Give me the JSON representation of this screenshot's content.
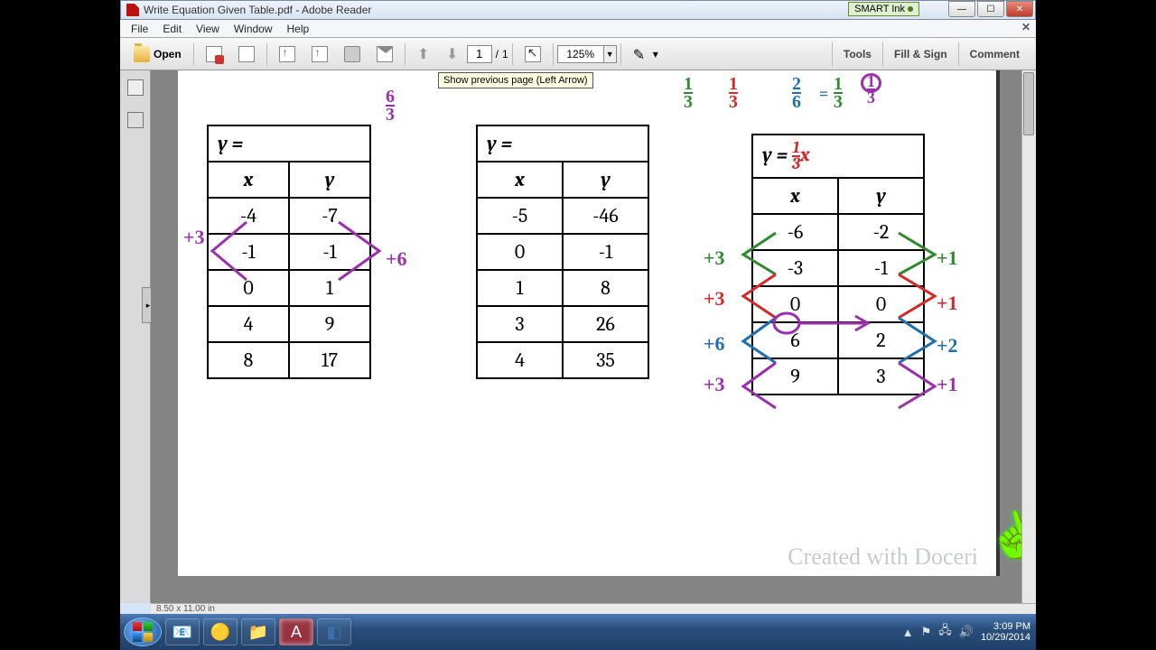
{
  "window": {
    "title": "Write Equation Given Table.pdf - Adobe Reader",
    "smart_ink": "SMART Ink"
  },
  "menu": {
    "file": "File",
    "edit": "Edit",
    "view": "View",
    "window": "Window",
    "help": "Help"
  },
  "toolbar": {
    "open": "Open",
    "page_current": "1",
    "page_total": "1",
    "page_sep": "/",
    "zoom": "125%",
    "tools": "Tools",
    "fill_sign": "Fill & Sign",
    "comment": "Comment"
  },
  "tooltip": "Show previous page (Left Arrow)",
  "tables": {
    "t1": {
      "eq": "y =",
      "cols": [
        "x",
        "y"
      ],
      "rows": [
        [
          "-4",
          "-7"
        ],
        [
          "-1",
          "-1"
        ],
        [
          "0",
          "1"
        ],
        [
          "4",
          "9"
        ],
        [
          "8",
          "17"
        ]
      ]
    },
    "t2": {
      "eq": "y =",
      "cols": [
        "x",
        "y"
      ],
      "rows": [
        [
          "-5",
          "-46"
        ],
        [
          "0",
          "-1"
        ],
        [
          "1",
          "8"
        ],
        [
          "3",
          "26"
        ],
        [
          "4",
          "35"
        ]
      ]
    },
    "t3": {
      "eq_prefix": "y = ",
      "eq_frac_n": "1",
      "eq_frac_d": "3",
      "eq_suffix": "x",
      "cols": [
        "x",
        "y"
      ],
      "rows": [
        [
          "-6",
          "-2"
        ],
        [
          "-3",
          "-1"
        ],
        [
          "0",
          "0"
        ],
        [
          "6",
          "2"
        ],
        [
          "9",
          "3"
        ]
      ]
    }
  },
  "ink": {
    "t1_top_n": "6",
    "t1_top_d": "3",
    "t1_left": "+3",
    "t1_right": "+6",
    "top_fracs": {
      "a_n": "1",
      "a_d": "3",
      "b_n": "1",
      "b_d": "3",
      "c_n": "2",
      "c_d": "6",
      "d_n": "1",
      "d_d": "3",
      "e_n": "1",
      "e_d": "3"
    },
    "t3_left": [
      "+3",
      "+3",
      "+6",
      "+3"
    ],
    "t3_right": [
      "+1",
      "+1",
      "+2",
      "+1"
    ]
  },
  "watermark": "Created with Doceri",
  "status": "8.50 x 11.00 in",
  "tray": {
    "time": "3:09 PM",
    "date": "10/29/2014"
  }
}
